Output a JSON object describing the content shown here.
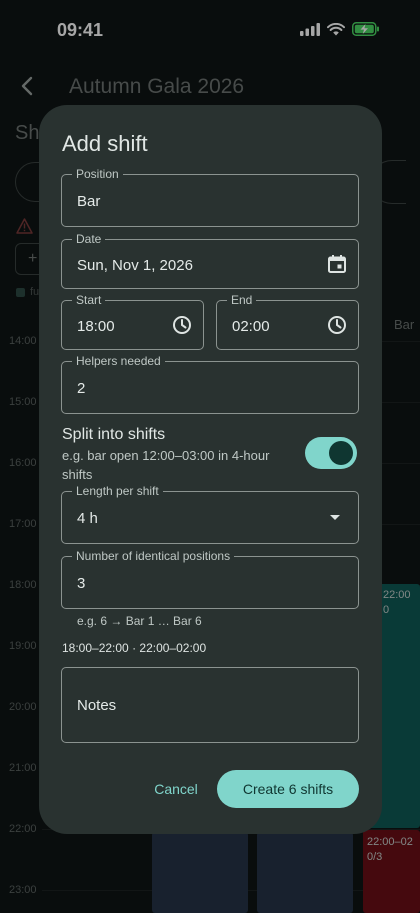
{
  "status_bar": {
    "time": "09:41",
    "icons": [
      "signal-icon",
      "wifi-icon",
      "battery-charging-icon"
    ]
  },
  "background": {
    "title": "Autumn Gala 2026",
    "heading_partial": "Sh",
    "add_button": "+",
    "chip_partial": "fu",
    "column_label": "Bar",
    "time_labels": [
      "14:00",
      "15:00",
      "16:00",
      "17:00",
      "18:00",
      "19:00",
      "20:00",
      "21:00",
      "22:00",
      "23:00"
    ],
    "block_labels": {
      "bar_1800_time": "22:00",
      "bar_1800_count": "0",
      "bar_2200_time": "22:00–02",
      "bar_2200_count": "0/3"
    },
    "colors": {
      "teal_block": "#0f5a55",
      "red_block": "#6b0f16",
      "blue_block": "#253447"
    }
  },
  "dialog": {
    "title": "Add shift",
    "position": {
      "label": "Position",
      "value": "Bar"
    },
    "date": {
      "label": "Date",
      "value": "Sun, Nov 1, 2026",
      "icon": "calendar-icon"
    },
    "start": {
      "label": "Start",
      "value": "18:00",
      "icon": "clock-icon"
    },
    "end": {
      "label": "End",
      "value": "02:00",
      "icon": "clock-icon"
    },
    "helpers": {
      "label": "Helpers needed",
      "value": "2"
    },
    "split": {
      "title": "Split into shifts",
      "description": "e.g. bar open 12:00–03:00 in 4-hour shifts",
      "enabled": true
    },
    "length": {
      "label": "Length per shift",
      "value": "4 h",
      "icon": "dropdown-arrow-icon"
    },
    "identical": {
      "label": "Number of identical positions",
      "value": "3",
      "helper": "e.g. 6 → Bar 1 … Bar 6"
    },
    "summary": "18:00–22:00 · 22:00–02:00",
    "notes": {
      "placeholder": "Notes"
    },
    "cancel_label": "Cancel",
    "create_label": "Create 6 shifts",
    "colors": {
      "accent": "#80d5cb",
      "surface": "#293230",
      "on_accent": "#0f3631"
    }
  }
}
